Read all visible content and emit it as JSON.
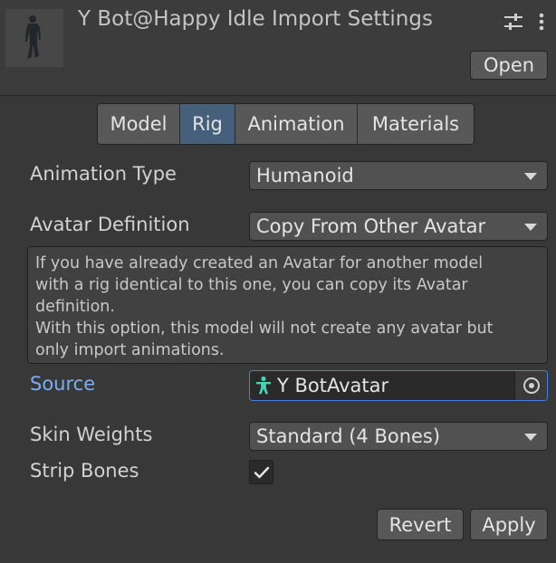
{
  "header": {
    "title": "Y Bot@Happy Idle Import Settings",
    "open_label": "Open",
    "settings_icon": "sliders-icon",
    "menu_icon": "kebab-menu-icon"
  },
  "tabs": [
    {
      "label": "Model",
      "active": false
    },
    {
      "label": "Rig",
      "active": true
    },
    {
      "label": "Animation",
      "active": false
    },
    {
      "label": "Materials",
      "active": false
    }
  ],
  "fields": {
    "animation_type": {
      "label": "Animation Type",
      "value": "Humanoid"
    },
    "avatar_definition": {
      "label": "Avatar Definition",
      "value": "Copy From Other Avatar"
    },
    "help_lines": [
      "If you have already created an Avatar for another model",
      "with a rig identical to this one, you can copy its Avatar",
      "definition.",
      "With this option, this model will not create any avatar but",
      "only import animations."
    ],
    "source": {
      "label": "Source",
      "value": "Y BotAvatar",
      "icon": "avatar-icon"
    },
    "skin_weights": {
      "label": "Skin Weights",
      "value": "Standard (4 Bones)"
    },
    "strip_bones": {
      "label": "Strip Bones",
      "checked": true
    }
  },
  "footer": {
    "revert_label": "Revert",
    "apply_label": "Apply"
  },
  "colors": {
    "active_tab": "#46607c",
    "accent_label": "#7baef0",
    "focus_border": "#3e86d8",
    "avatar_icon": "#4ad3b3"
  }
}
